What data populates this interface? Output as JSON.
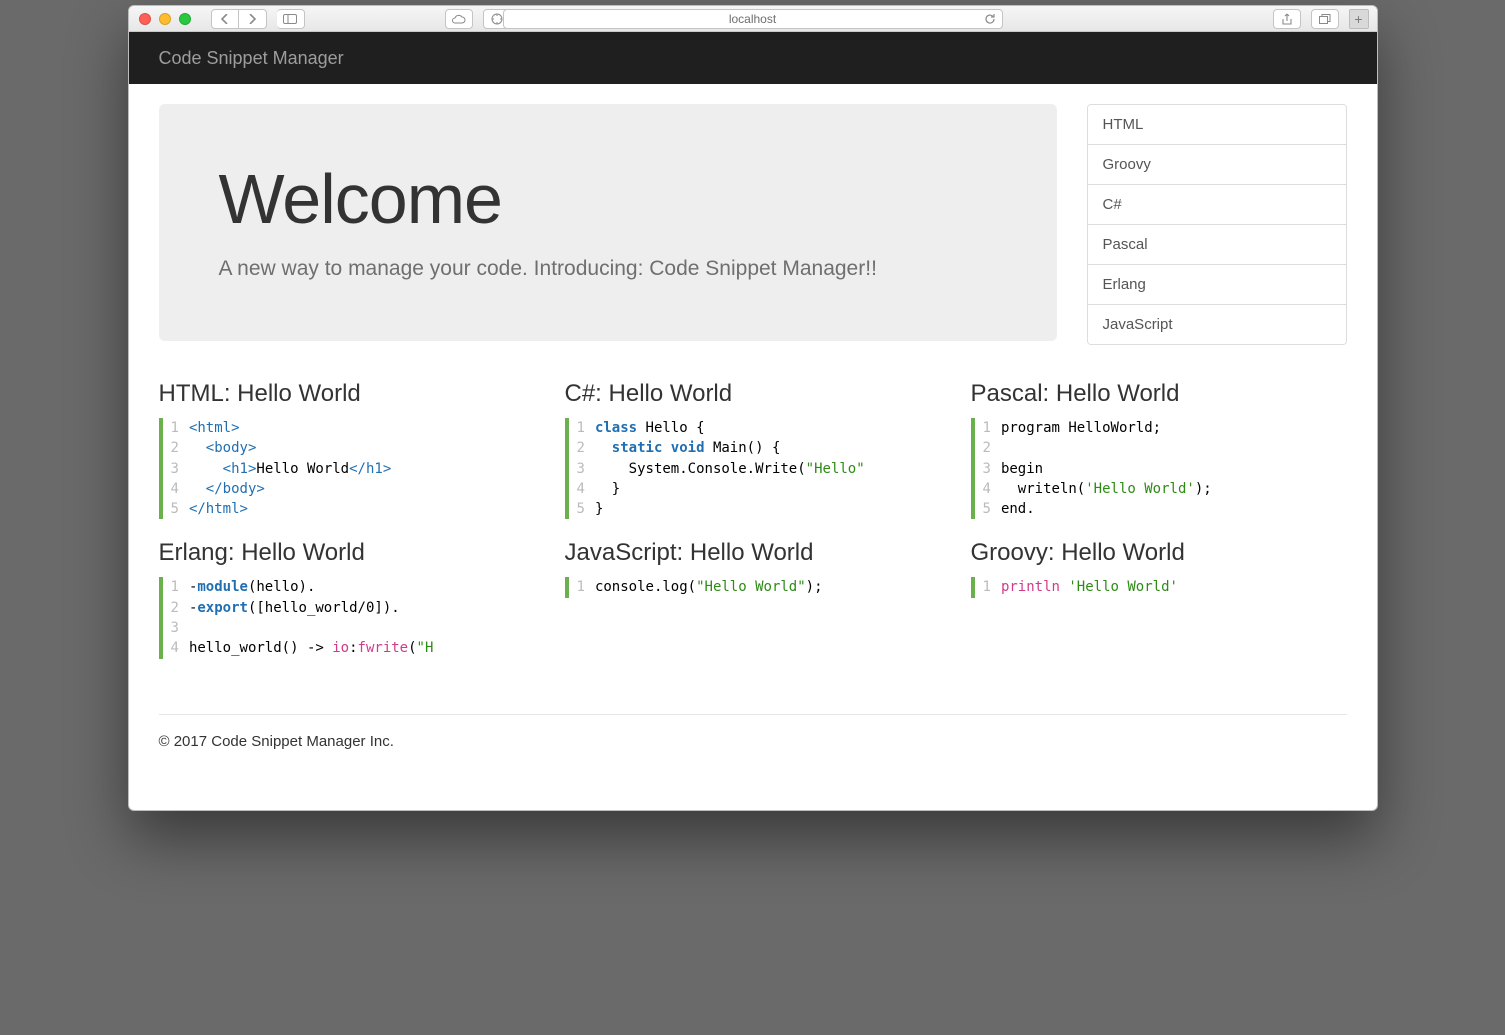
{
  "browser": {
    "address": "localhost"
  },
  "nav": {
    "brand": "Code Snippet Manager"
  },
  "hero": {
    "title": "Welcome",
    "subtitle": "A new way to manage your code. Introducing: Code Snippet Manager!!"
  },
  "languages": [
    "HTML",
    "Groovy",
    "C#",
    "Pascal",
    "Erlang",
    "JavaScript"
  ],
  "snippets": [
    {
      "title": "HTML: Hello World",
      "lines": [
        [
          {
            "t": "<",
            "c": "tag"
          },
          {
            "t": "html",
            "c": "tag"
          },
          {
            "t": ">",
            "c": "tag"
          }
        ],
        [
          {
            "t": "  "
          },
          {
            "t": "<",
            "c": "tag"
          },
          {
            "t": "body",
            "c": "tag"
          },
          {
            "t": ">",
            "c": "tag"
          }
        ],
        [
          {
            "t": "    "
          },
          {
            "t": "<",
            "c": "tag"
          },
          {
            "t": "h1",
            "c": "tag"
          },
          {
            "t": ">",
            "c": "tag"
          },
          {
            "t": "Hello World"
          },
          {
            "t": "</",
            "c": "tag"
          },
          {
            "t": "h1",
            "c": "tag"
          },
          {
            "t": ">",
            "c": "tag"
          }
        ],
        [
          {
            "t": "  "
          },
          {
            "t": "</",
            "c": "tag"
          },
          {
            "t": "body",
            "c": "tag"
          },
          {
            "t": ">",
            "c": "tag"
          }
        ],
        [
          {
            "t": "</",
            "c": "tag"
          },
          {
            "t": "html",
            "c": "tag"
          },
          {
            "t": ">",
            "c": "tag"
          }
        ]
      ]
    },
    {
      "title": "C#: Hello World",
      "lines": [
        [
          {
            "t": "class ",
            "c": "kw"
          },
          {
            "t": "Hello {"
          }
        ],
        [
          {
            "t": "  "
          },
          {
            "t": "static void ",
            "c": "kw"
          },
          {
            "t": "Main() {"
          }
        ],
        [
          {
            "t": "    System.Console.Write("
          },
          {
            "t": "\"Hello\"",
            "c": "str"
          }
        ],
        [
          {
            "t": "  }"
          }
        ],
        [
          {
            "t": "}"
          }
        ]
      ]
    },
    {
      "title": "Pascal: Hello World",
      "lines": [
        [
          {
            "t": "program HelloWorld;"
          }
        ],
        [
          {
            "t": ""
          }
        ],
        [
          {
            "t": "begin"
          }
        ],
        [
          {
            "t": "  writeln("
          },
          {
            "t": "'Hello World'",
            "c": "str"
          },
          {
            "t": ");"
          }
        ],
        [
          {
            "t": "end."
          }
        ]
      ]
    },
    {
      "title": "Erlang: Hello World",
      "lines": [
        [
          {
            "t": "-"
          },
          {
            "t": "module",
            "c": "kw"
          },
          {
            "t": "(hello)."
          }
        ],
        [
          {
            "t": "-"
          },
          {
            "t": "export",
            "c": "kw"
          },
          {
            "t": "([hello_world/0])."
          }
        ],
        [
          {
            "t": ""
          }
        ],
        [
          {
            "t": "hello_world() -> "
          },
          {
            "t": "io",
            "c": "fn"
          },
          {
            "t": ":"
          },
          {
            "t": "fwrite",
            "c": "fn"
          },
          {
            "t": "("
          },
          {
            "t": "\"H",
            "c": "str"
          }
        ]
      ]
    },
    {
      "title": "JavaScript: Hello World",
      "lines": [
        [
          {
            "t": "console.log("
          },
          {
            "t": "\"Hello World\"",
            "c": "str"
          },
          {
            "t": ");"
          }
        ]
      ]
    },
    {
      "title": "Groovy: Hello World",
      "lines": [
        [
          {
            "t": "println ",
            "c": "fn"
          },
          {
            "t": "'Hello World'",
            "c": "str"
          }
        ]
      ]
    }
  ],
  "footer": "© 2017 Code Snippet Manager Inc."
}
